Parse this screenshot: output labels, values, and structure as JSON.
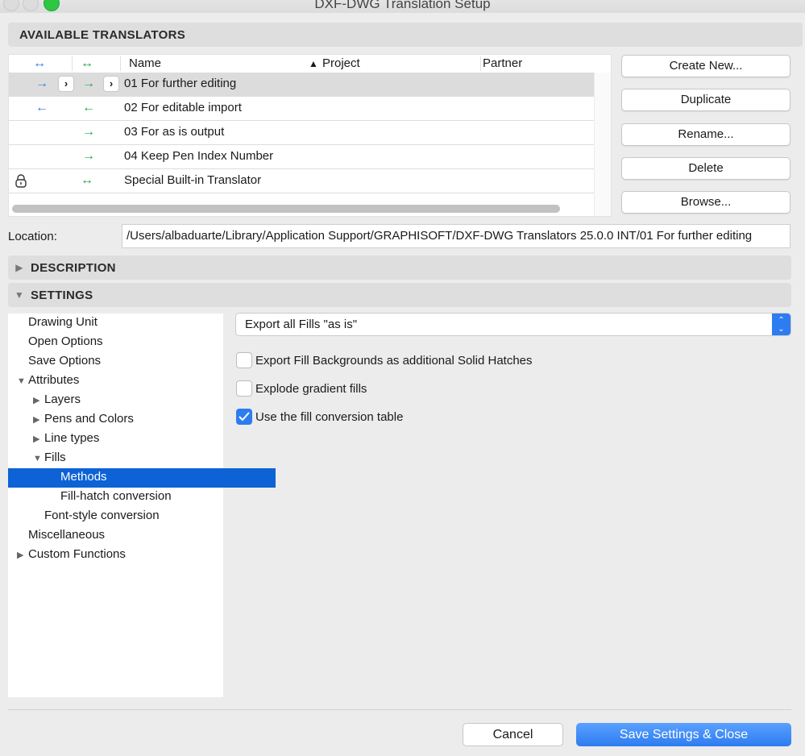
{
  "window": {
    "title": "DXF-DWG Translation Setup"
  },
  "sections": {
    "available_translators": "AVAILABLE TRANSLATORS",
    "description": "DESCRIPTION",
    "settings": "SETTINGS"
  },
  "table": {
    "header_icons": {
      "import_export": "↔",
      "open_save": "↔"
    },
    "columns": {
      "name": "Name",
      "project": "Project",
      "partner": "Partner"
    },
    "sort_indicator": "▲",
    "rows": [
      {
        "name": "01 For further editing",
        "col1": "→",
        "col2": "→",
        "chevron1": "›",
        "chevron2": "›",
        "lock": ""
      },
      {
        "name": "02 For editable import",
        "col1": "←",
        "col2": "←",
        "lock": ""
      },
      {
        "name": "03 For as is output",
        "col1": "",
        "col2": "→",
        "lock": ""
      },
      {
        "name": "04 Keep Pen Index Number",
        "col1": "",
        "col2": "→",
        "lock": ""
      },
      {
        "name": "Special Built-in Translator",
        "col1": "",
        "col2": "↔",
        "lock": "lock-icon"
      }
    ]
  },
  "side_buttons": {
    "create_new": "Create New...",
    "duplicate": "Duplicate",
    "rename": "Rename...",
    "delete": "Delete",
    "browse": "Browse..."
  },
  "location": {
    "label": "Location:",
    "value": "/Users/albaduarte/Library/Application Support/GRAPHISOFT/DXF-DWG Translators 25.0.0 INT/01 For further editing"
  },
  "tree": {
    "drawing_unit": "Drawing Unit",
    "open_options": "Open Options",
    "save_options": "Save Options",
    "attributes": "Attributes",
    "layers": "Layers",
    "pens_and_colors": "Pens and Colors",
    "line_types": "Line types",
    "fills": "Fills",
    "methods": "Methods",
    "fill_hatch_conversion": "Fill-hatch conversion",
    "font_style_conversion": "Font-style conversion",
    "miscellaneous": "Miscellaneous",
    "custom_functions": "Custom Functions"
  },
  "settings": {
    "fill_export_select": "Export all Fills \"as is\"",
    "options": [
      {
        "label": "Export Fill Backgrounds as additional Solid Hatches",
        "checked": false
      },
      {
        "label": "Explode gradient fills",
        "checked": false
      },
      {
        "label": "Use the fill conversion table",
        "checked": true
      }
    ]
  },
  "footer": {
    "cancel": "Cancel",
    "save": "Save Settings & Close"
  },
  "colors": {
    "accent": "#2d7cf0",
    "selection": "#0d62d6",
    "green_arrow": "#27a345",
    "blue_arrow": "#2d7be0"
  }
}
